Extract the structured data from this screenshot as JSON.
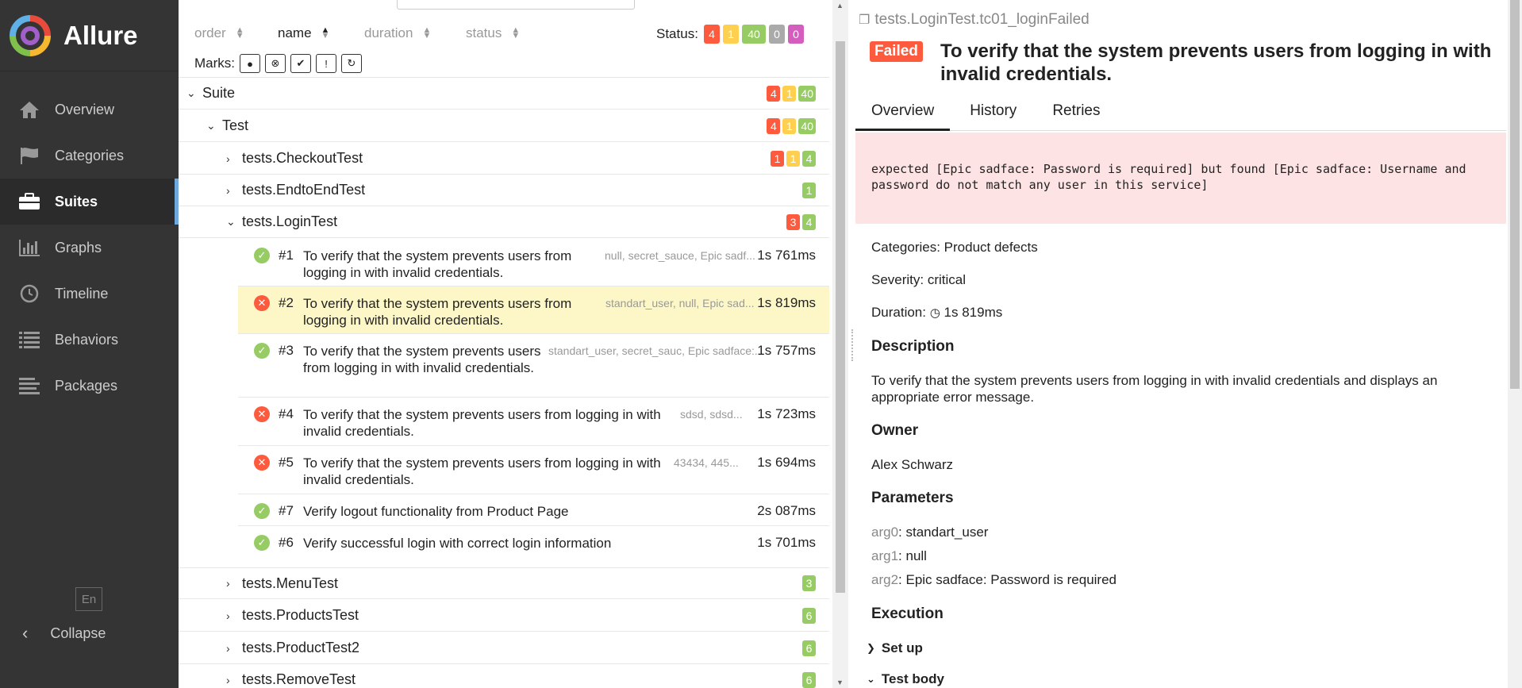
{
  "app": {
    "name": "Allure"
  },
  "sidebar": {
    "items": [
      {
        "label": "Overview",
        "icon": "home-icon"
      },
      {
        "label": "Categories",
        "icon": "flag-icon"
      },
      {
        "label": "Suites",
        "icon": "briefcase-icon",
        "active": true
      },
      {
        "label": "Graphs",
        "icon": "bar-chart-icon"
      },
      {
        "label": "Timeline",
        "icon": "clock-icon"
      },
      {
        "label": "Behaviors",
        "icon": "list-icon"
      },
      {
        "label": "Packages",
        "icon": "align-left-icon"
      }
    ],
    "language": "En",
    "collapse": "Collapse"
  },
  "toolbar": {
    "sort": [
      "order",
      "name",
      "duration",
      "status"
    ],
    "active_sort": "name",
    "status_label": "Status:",
    "status_counts": [
      "4",
      "1",
      "40",
      "0",
      "0"
    ],
    "marks_label": "Marks:"
  },
  "tree": {
    "suite": {
      "label": "Suite",
      "counts": [
        "4",
        "1",
        "40"
      ]
    },
    "test": {
      "label": "Test",
      "counts": [
        "4",
        "1",
        "40"
      ]
    },
    "classes": [
      {
        "label": "tests.CheckoutTest",
        "counts": [
          "1",
          "1",
          "4"
        ]
      },
      {
        "label": "tests.EndtoEndTest",
        "counts": [
          "1"
        ]
      },
      {
        "label": "tests.LoginTest",
        "counts": [
          "3",
          "4"
        ]
      },
      {
        "label": "tests.MenuTest",
        "counts": [
          "3"
        ]
      },
      {
        "label": "tests.ProductsTest",
        "counts": [
          "6"
        ]
      },
      {
        "label": "tests.ProductTest2",
        "counts": [
          "6"
        ]
      },
      {
        "label": "tests.RemoveTest",
        "counts": [
          "6"
        ]
      }
    ],
    "login_tests": [
      {
        "num": "#1",
        "name": "To verify that the system prevents users from logging in with invalid credentials.",
        "params": "null, secret_sauce, Epic sadf...",
        "duration": "1s 761ms",
        "status": "passed"
      },
      {
        "num": "#2",
        "name": "To verify that the system prevents users from logging in with invalid credentials.",
        "params": "standart_user, null, Epic sad...",
        "duration": "1s 819ms",
        "status": "failed"
      },
      {
        "num": "#3",
        "name": "To verify that the system prevents users from logging in with invalid credentials.",
        "params": "standart_user, secret_sauc, Epic sadface:...",
        "duration": "1s 757ms",
        "status": "passed"
      },
      {
        "num": "#4",
        "name": "To verify that the system prevents users from logging in with invalid credentials.",
        "params": "sdsd, sdsd...",
        "duration": "1s 723ms",
        "status": "failed"
      },
      {
        "num": "#5",
        "name": "To verify that the system prevents users from logging in with invalid credentials.",
        "params": "43434, 445...",
        "duration": "1s 694ms",
        "status": "failed"
      },
      {
        "num": "#7",
        "name": "Verify logout functionality from Product Page",
        "params": "",
        "duration": "2s 087ms",
        "status": "passed"
      },
      {
        "num": "#6",
        "name": "Verify successful login with correct login information",
        "params": "",
        "duration": "1s 701ms",
        "status": "passed"
      }
    ]
  },
  "detail": {
    "path": "tests.LoginTest.tc01_loginFailed",
    "status": "Failed",
    "title": "To verify that the system prevents users from logging in with invalid credentials.",
    "tabs": [
      "Overview",
      "History",
      "Retries"
    ],
    "error": "expected [Epic sadface: Password is required] but found [Epic sadface: Username and password do not match any user in this service]",
    "categories": "Categories: Product defects",
    "severity": "Severity: critical",
    "duration_label": "Duration:",
    "duration": "1s 819ms",
    "description_heading": "Description",
    "description": "To verify that the system prevents users from logging in with invalid credentials and displays an appropriate error message.",
    "owner_heading": "Owner",
    "owner": "Alex Schwarz",
    "parameters_heading": "Parameters",
    "parameters": [
      {
        "key": "arg0",
        "value": "standart_user"
      },
      {
        "key": "arg1",
        "value": "null"
      },
      {
        "key": "arg2",
        "value": "Epic sadface: Password is required"
      }
    ],
    "execution_heading": "Execution",
    "setup": "Set up",
    "body": "Test body"
  },
  "colors": {
    "failed": "#fd5a3e",
    "broken": "#ffd050",
    "passed": "#97cc64",
    "skipped": "#aaaaaa",
    "unknown": "#d35ebe",
    "selected_row": "#fdf7c8"
  }
}
